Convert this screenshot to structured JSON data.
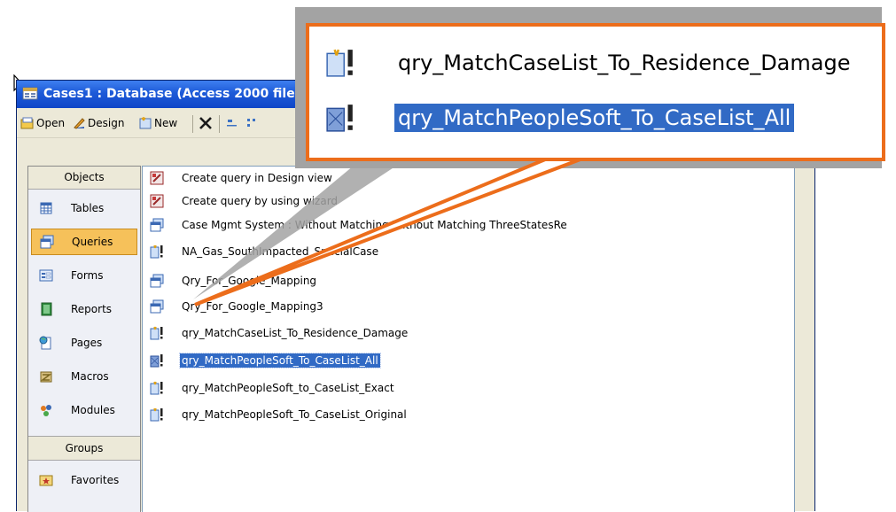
{
  "window": {
    "title": "Cases1 : Database (Access 2000 file"
  },
  "toolbar": {
    "open_label": "Open",
    "design_label": "Design",
    "new_label": "New",
    "delete_icon": "delete-icon",
    "view_icons": [
      "large-icons-icon",
      "small-icons-icon"
    ]
  },
  "objects_bar": {
    "header": "Objects",
    "items": [
      {
        "label": "Tables",
        "icon": "table-icon"
      },
      {
        "label": "Queries",
        "icon": "query-icon",
        "selected": true
      },
      {
        "label": "Forms",
        "icon": "form-icon"
      },
      {
        "label": "Reports",
        "icon": "report-icon"
      },
      {
        "label": "Pages",
        "icon": "page-icon"
      },
      {
        "label": "Macros",
        "icon": "macro-icon"
      },
      {
        "label": "Modules",
        "icon": "module-icon"
      }
    ],
    "groups_header": "Groups",
    "groups": [
      {
        "label": "Favorites",
        "icon": "favorites-icon"
      }
    ]
  },
  "query_list": [
    {
      "label": "Create query in Design view",
      "icon": "wizard-icon"
    },
    {
      "label": "Create query by using wizard",
      "icon": "wizard-icon"
    },
    {
      "label": "Case Mgmt System : Without Matching Without Matching ThreeStatesRe",
      "icon": "select-query-icon"
    },
    {
      "label": "NA_Gas_SouthImpacted_SpecialCase",
      "icon": "action-query-icon"
    },
    {
      "label": "Qry_For_Google_Mapping",
      "icon": "select-query-icon"
    },
    {
      "label": "Qry_For_Google_Mapping3",
      "icon": "select-query-icon"
    },
    {
      "label": "qry_MatchCaseList_To_Residence_Damage",
      "icon": "action-query-icon"
    },
    {
      "label": "qry_MatchPeopleSoft_To_CaseList_All",
      "icon": "action-query-icon",
      "selected": true
    },
    {
      "label": "qry_MatchPeopleSoft_to_CaseList_Exact",
      "icon": "action-query-icon"
    },
    {
      "label": "qry_MatchPeopleSoft_To_CaseList_Original",
      "icon": "action-query-icon"
    }
  ],
  "callout": {
    "items": [
      {
        "label": "qry_MatchCaseList_To_Residence_Damage",
        "icon": "action-query-icon"
      },
      {
        "label": "qry_MatchPeopleSoft_To_CaseList_All",
        "icon": "action-query-icon",
        "selected": true
      }
    ],
    "border_color": "#ec6d1b"
  },
  "colors": {
    "titlebar": "#1d5ad8",
    "selection": "#316ac5",
    "objects_selected": "#f6c15a"
  }
}
